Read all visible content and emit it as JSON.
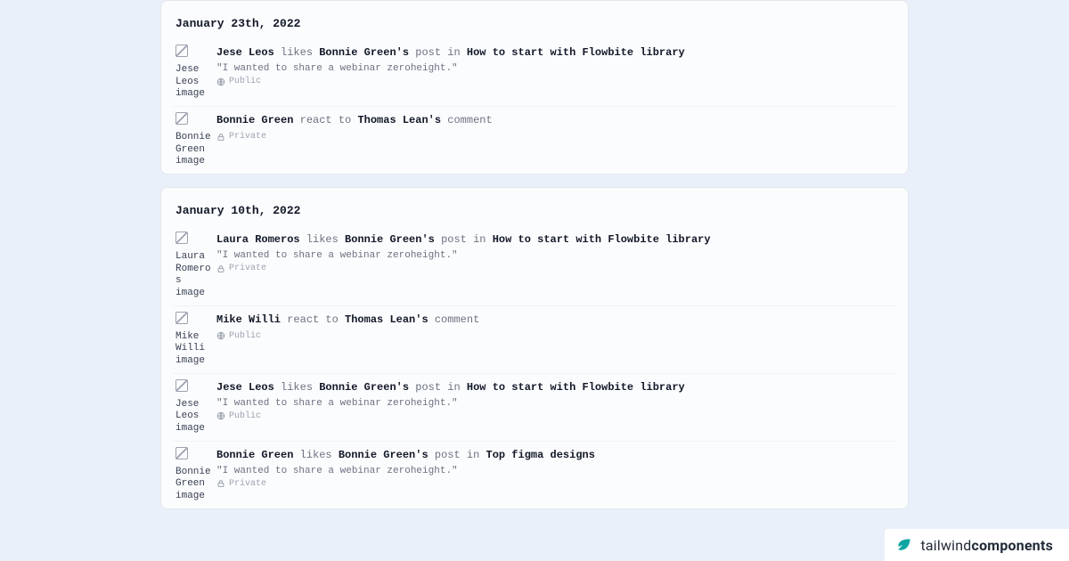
{
  "groups": [
    {
      "date": "January 23th, 2022",
      "items": [
        {
          "avatar_alt": "Jese Leos image",
          "actor": "Jese Leos",
          "verb": "likes",
          "target_owner": "Bonnie Green's",
          "target_type": "post in",
          "target_title": "How to start with Flowbite library",
          "quote": "\"I wanted to share a webinar zeroheight.\"",
          "visibility": "Public"
        },
        {
          "avatar_alt": "Bonnie Green image",
          "actor": "Bonnie Green",
          "verb": "react to",
          "target_owner": "Thomas Lean's",
          "target_type": "comment",
          "target_title": "",
          "quote": "",
          "visibility": "Private"
        }
      ]
    },
    {
      "date": "January 10th, 2022",
      "items": [
        {
          "avatar_alt": "Laura Romeros image",
          "actor": "Laura Romeros",
          "verb": "likes",
          "target_owner": "Bonnie Green's",
          "target_type": "post in",
          "target_title": "How to start with Flowbite library",
          "quote": "\"I wanted to share a webinar zeroheight.\"",
          "visibility": "Private"
        },
        {
          "avatar_alt": "Mike Willi image",
          "actor": "Mike Willi",
          "verb": "react to",
          "target_owner": "Thomas Lean's",
          "target_type": "comment",
          "target_title": "",
          "quote": "",
          "visibility": "Public"
        },
        {
          "avatar_alt": "Jese Leos image",
          "actor": "Jese Leos",
          "verb": "likes",
          "target_owner": "Bonnie Green's",
          "target_type": "post in",
          "target_title": "How to start with Flowbite library",
          "quote": "\"I wanted to share a webinar zeroheight.\"",
          "visibility": "Public"
        },
        {
          "avatar_alt": "Bonnie Green image",
          "actor": "Bonnie Green",
          "verb": "likes",
          "target_owner": "Bonnie Green's",
          "target_type": "post in",
          "target_title": "Top figma designs",
          "quote": "\"I wanted to share a webinar zeroheight.\"",
          "visibility": "Private"
        }
      ]
    }
  ],
  "brand": {
    "word1": "tailwind",
    "word2": "components"
  }
}
